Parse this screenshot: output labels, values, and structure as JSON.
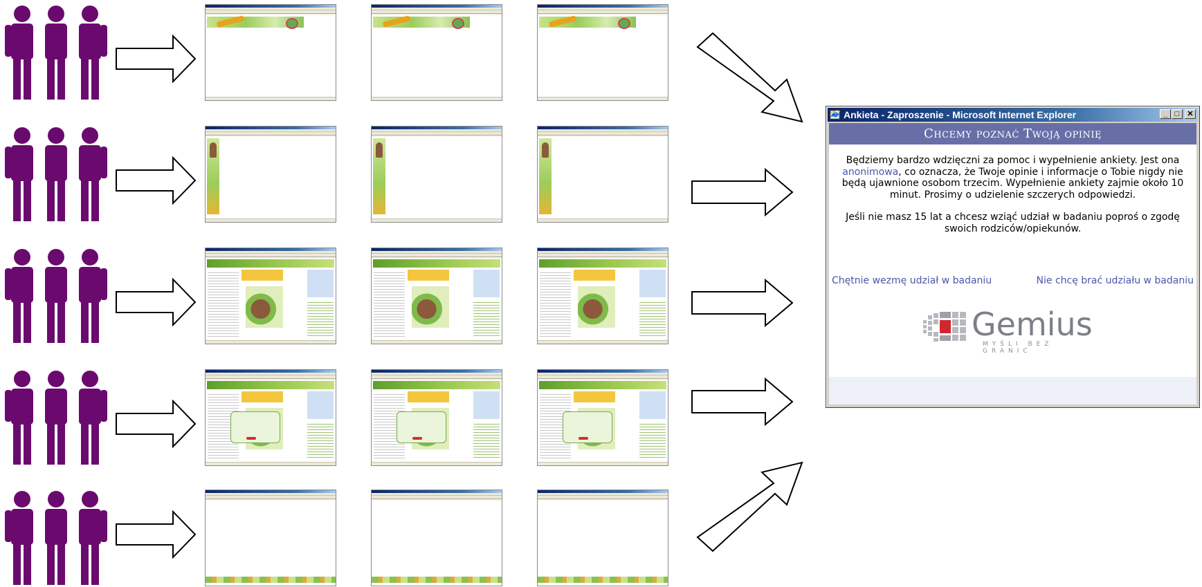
{
  "window": {
    "title": "Ankieta - Zaproszenie - Microsoft Internet Explorer",
    "controls": {
      "minimize": "_",
      "maximize": "□",
      "close": "✕"
    }
  },
  "survey": {
    "header": "Chcemy poznać Twoją opinię",
    "paragraph1_before_link": "Będziemy bardzo wdzięczni za pomoc i wypełnienie ankiety. Jest ona ",
    "paragraph1_link": "anonimowa",
    "paragraph1_after_link": ", co oznacza, że Twoje opinie i informacje o Tobie nigdy nie będą ujawnione osobom trzecim. Wypełnienie ankiety zajmie około 10 minut. Prosimy o udzielenie szczerych odpowiedzi.",
    "paragraph2": "Jeśli nie masz 15 lat a chcesz wziąć udział w badaniu poproś o zgodę swoich rodziców/opiekunów.",
    "accept_link": "Chętnie wezmę udział w badaniu",
    "decline_link": "Nie chcę brać udziału w badaniu"
  },
  "brand": {
    "logo_word": "Gemius",
    "logo_tagline": "MYŚLI BEZ GRANIC"
  },
  "colors": {
    "people": "#6b0a6e",
    "header_band": "#686fa7",
    "link": "#4a57a8",
    "logo_red": "#d0262e",
    "logo_gray": "#7c7f88"
  },
  "diagram": {
    "rows": [
      {
        "group_icon": "people-group-icon",
        "screenshot_variant": "top-banner"
      },
      {
        "group_icon": "people-group-icon",
        "screenshot_variant": "side-banner"
      },
      {
        "group_icon": "people-group-icon",
        "screenshot_variant": "site-page"
      },
      {
        "group_icon": "people-group-icon",
        "screenshot_variant": "site-page-with-popup"
      },
      {
        "group_icon": "people-group-icon",
        "screenshot_variant": "footer-banner"
      }
    ]
  }
}
